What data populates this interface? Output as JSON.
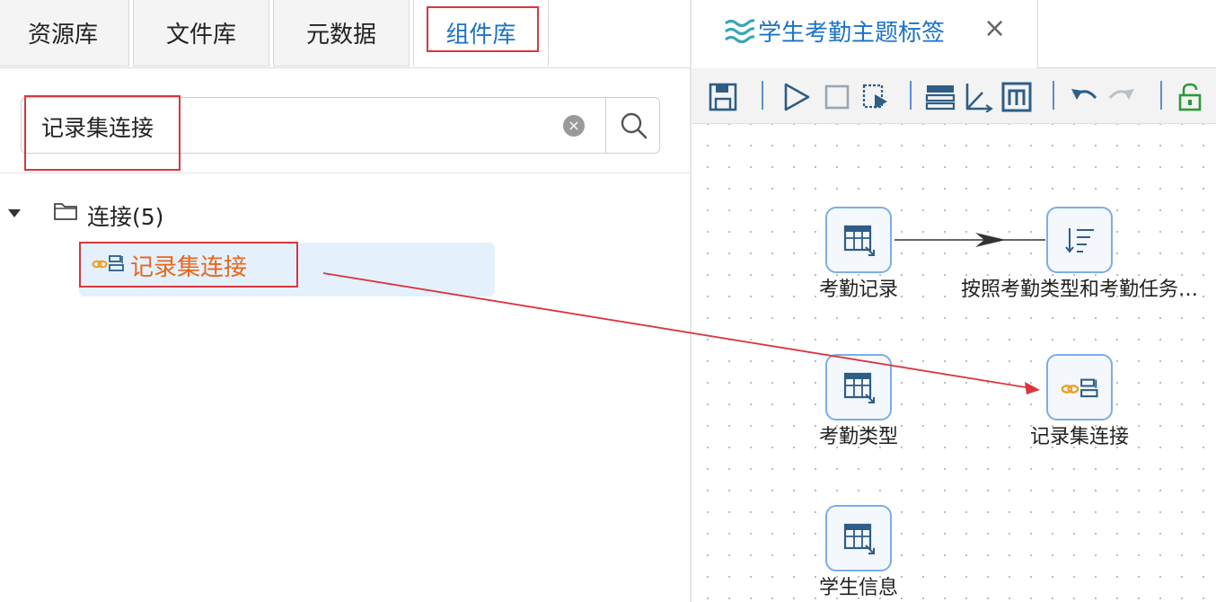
{
  "left_tabs": [
    {
      "label": "资源库"
    },
    {
      "label": "文件库"
    },
    {
      "label": "元数据"
    },
    {
      "label": "组件库"
    }
  ],
  "search": {
    "value": "记录集连接",
    "clear_symbol": "×"
  },
  "tree": {
    "folder_label": "连接(5)",
    "item_label": "记录集连接"
  },
  "editor": {
    "tab_title": "学生考勤主题标签",
    "close_symbol": "×"
  },
  "canvas_nodes": [
    {
      "label": "考勤记录",
      "icon": "table-input-icon"
    },
    {
      "label": "按照考勤类型和考勤任务…",
      "icon": "sort-icon"
    },
    {
      "label": "考勤类型",
      "icon": "table-input-icon"
    },
    {
      "label": "记录集连接",
      "icon": "merge-join-icon"
    },
    {
      "label": "学生信息",
      "icon": "table-input-icon"
    }
  ],
  "toolbar_icons": [
    "save-icon",
    "run-icon",
    "stop-icon",
    "preview-icon",
    "layout-icon",
    "align-icon",
    "metrics-icon",
    "undo-icon",
    "redo-icon",
    "unlock-icon"
  ],
  "colors": {
    "accent": "#1a73c8",
    "highlight_text": "#e8671a",
    "annotation": "#d9363e",
    "selection_bg": "#e4f1fd"
  }
}
